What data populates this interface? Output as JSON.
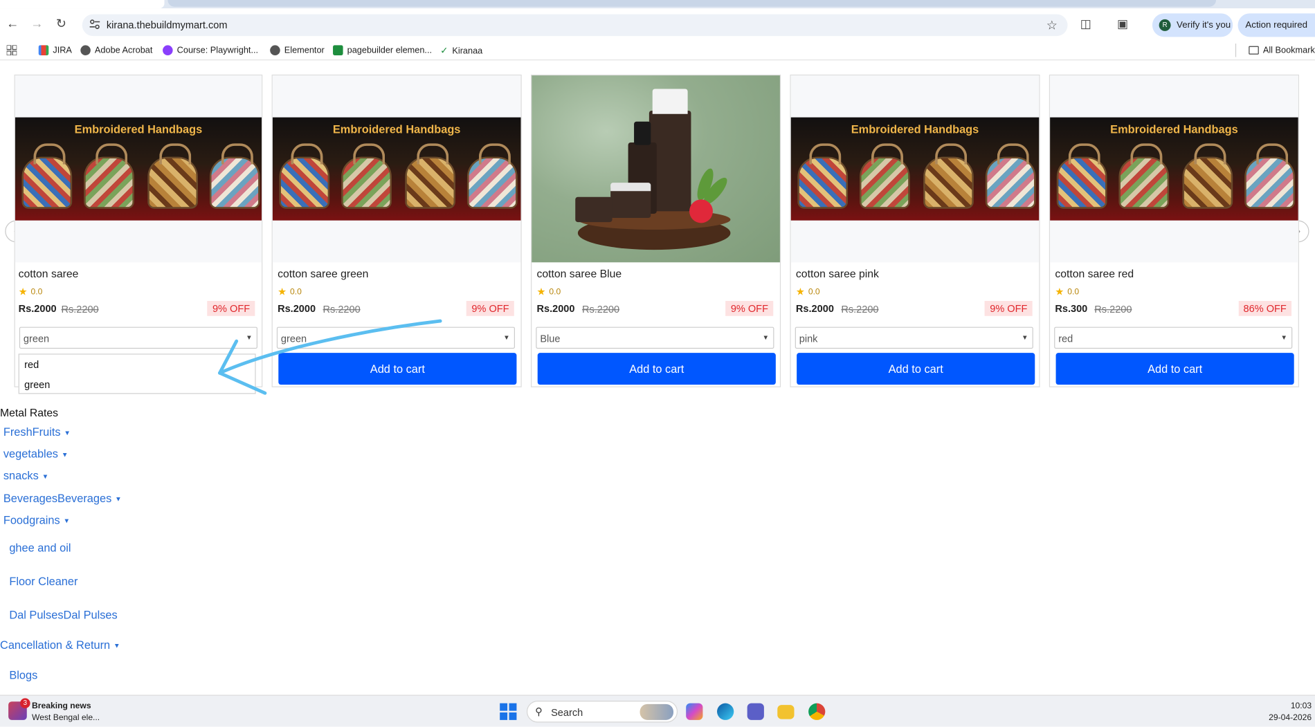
{
  "browser": {
    "url": "kirana.thebuildmymart.com",
    "verify_label": "Verify it's you",
    "verify_avatar": "R",
    "action_label": "Action required",
    "bookmarks": [
      {
        "label": "JIRA",
        "icon": "gmail-icon"
      },
      {
        "label": "Adobe Acrobat",
        "icon": "globe-icon"
      },
      {
        "label": "Course: Playwright...",
        "icon": "udemy-icon"
      },
      {
        "label": "Elementor",
        "icon": "globe-icon"
      },
      {
        "label": "pagebuilder elemen...",
        "icon": "sheets-icon"
      },
      {
        "label": "Kiranaa",
        "icon": "check-icon"
      }
    ],
    "all_bookmarks": "All Bookmarks"
  },
  "products": [
    {
      "name": "cotton saree",
      "rating": "0.0",
      "price": "Rs.2000",
      "mrp": "Rs.2200",
      "off": "9% OFF",
      "selected": "green",
      "image": "Embroidered Handbags",
      "add_label": ""
    },
    {
      "name": "cotton saree green",
      "rating": "0.0",
      "price": "Rs.2000",
      "mrp": "Rs.2200",
      "off": "9% OFF",
      "selected": "green",
      "image": "Embroidered Handbags",
      "add_label": "Add to cart"
    },
    {
      "name": "cotton saree Blue",
      "rating": "0.0",
      "price": "Rs.2000",
      "mrp": "Rs.2200",
      "off": "9% OFF",
      "selected": "Blue",
      "image": "cosmetics",
      "add_label": "Add to cart"
    },
    {
      "name": "cotton saree pink",
      "rating": "0.0",
      "price": "Rs.2000",
      "mrp": "Rs.2200",
      "off": "9% OFF",
      "selected": "pink",
      "image": "Embroidered Handbags",
      "add_label": "Add to cart"
    },
    {
      "name": "cotton saree red",
      "rating": "0.0",
      "price": "Rs.300",
      "mrp": "Rs.2200",
      "off": "86% OFF",
      "selected": "red",
      "image": "Embroidered Handbags",
      "add_label": "Add to cart"
    }
  ],
  "dropdown": {
    "options": [
      "red",
      "green"
    ]
  },
  "menu": {
    "heading": "Metal Rates",
    "items": [
      {
        "label": "FreshFruits",
        "caret": true
      },
      {
        "label": "vegetables",
        "caret": true
      },
      {
        "label": "snacks",
        "caret": true
      },
      {
        "label": "BeveragesBeverages",
        "caret": true
      },
      {
        "label": "Foodgrains",
        "caret": true
      },
      {
        "label": "ghee and oil",
        "caret": false
      },
      {
        "label": "Floor Cleaner",
        "caret": false
      },
      {
        "label": "Dal PulsesDal Pulses",
        "caret": false
      },
      {
        "label": "Cancellation & Return",
        "caret": true
      },
      {
        "label": "Blogs",
        "caret": false
      }
    ]
  },
  "taskbar": {
    "news_title": "Breaking news",
    "news_sub": "West Bengal ele...",
    "news_badge": "3",
    "search_label": "Search",
    "time": "10:03",
    "date": "29-04-2026"
  },
  "colors": {
    "primary_button": "#0057ff",
    "discount_text": "#e0262b",
    "link": "#2a6fd6",
    "star": "#f5b301"
  }
}
